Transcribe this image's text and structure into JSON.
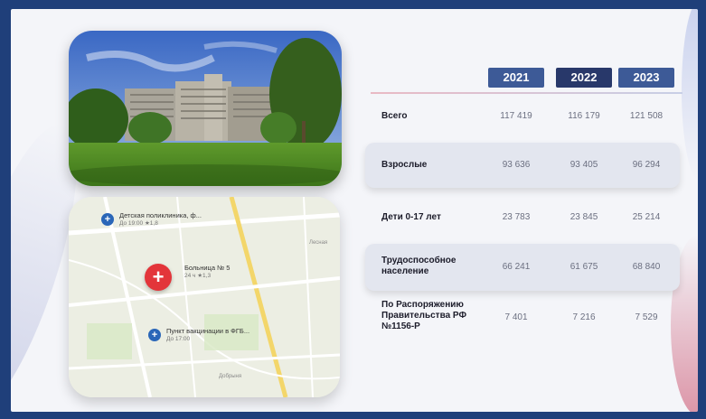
{
  "table": {
    "years": [
      "2021",
      "2022",
      "2023"
    ],
    "rows": [
      {
        "label": "Всего",
        "values": [
          "117 419",
          "116 179",
          "121 508"
        ]
      },
      {
        "label": "Взрослые",
        "values": [
          "93 636",
          "93 405",
          "96 294"
        ]
      },
      {
        "label": "Дети 0-17 лет",
        "values": [
          "23 783",
          "23 845",
          "25 214"
        ]
      },
      {
        "label": "Трудоспособное население",
        "values": [
          "66 241",
          "61 675",
          "68 840"
        ]
      },
      {
        "label": "По Распоряжению Правительства РФ №1156-Р",
        "values": [
          "7 401",
          "7 216",
          "7 529"
        ]
      }
    ]
  },
  "map": {
    "pins": [
      {
        "title": "Детская поликлиника, ф...",
        "subtitle": "До 19:00  ★1,8"
      },
      {
        "title": "Больница № 5",
        "subtitle": "24 ч  ★1,3"
      },
      {
        "title": "Пункт вакцинации в ФГБ...",
        "subtitle": "До 17:00"
      }
    ],
    "roads": [
      "Лесная",
      "Добрыня"
    ]
  },
  "colors": {
    "frame_border": "#1f3f7a",
    "year_header": "#3d5a97",
    "year_header_dark": "#28386a",
    "map_pin": "#e3353a",
    "map_marker": "#2a66b8"
  }
}
